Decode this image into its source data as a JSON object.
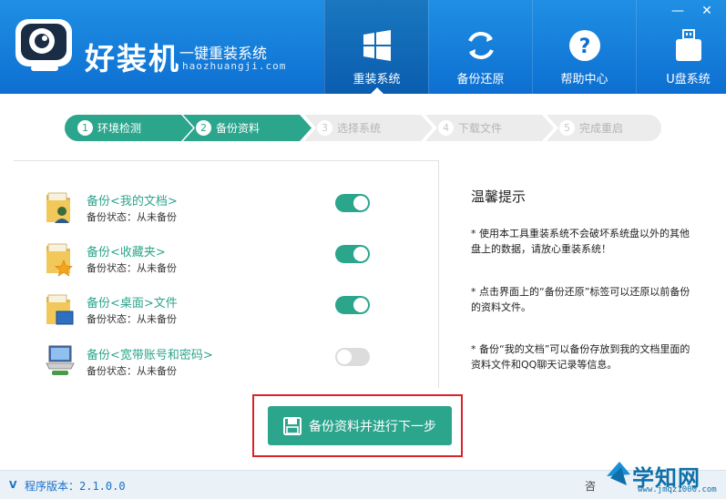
{
  "header": {
    "brand_name": "好装机",
    "slogan": "一键重装系统",
    "domain": "haozhuangji.com",
    "window_controls": {
      "minimize": "—",
      "close": "✕"
    },
    "nav": [
      {
        "label": "重装系统",
        "icon": "windows-icon",
        "active": true
      },
      {
        "label": "备份还原",
        "icon": "sync-icon",
        "active": false
      },
      {
        "label": "帮助中心",
        "icon": "help-icon",
        "active": false
      },
      {
        "label": "U盘系统",
        "icon": "usb-icon",
        "active": false,
        "badge": "USB"
      }
    ]
  },
  "steps": [
    {
      "num": "1",
      "label": "环境检测",
      "state": "done"
    },
    {
      "num": "2",
      "label": "备份资料",
      "state": "done"
    },
    {
      "num": "3",
      "label": "选择系统",
      "state": "todo"
    },
    {
      "num": "4",
      "label": "下载文件",
      "state": "todo"
    },
    {
      "num": "5",
      "label": "完成重启",
      "state": "todo"
    }
  ],
  "backup_items": [
    {
      "title": "备份<我的文档>",
      "status": "备份状态：从未备份",
      "enabled": true,
      "icon": "documents-folder-icon"
    },
    {
      "title": "备份<收藏夹>",
      "status": "备份状态：从未备份",
      "enabled": true,
      "icon": "favorites-folder-icon"
    },
    {
      "title": "备份<桌面>文件",
      "status": "备份状态：从未备份",
      "enabled": true,
      "icon": "desktop-folder-icon"
    },
    {
      "title": "备份<宽带账号和密码>",
      "status": "备份状态：从未备份",
      "enabled": false,
      "icon": "network-icon"
    }
  ],
  "tips": {
    "title": "温馨提示",
    "items": [
      "* 使用本工具重装系统不会破坏系统盘以外的其他盘上的数据，请放心重装系统！",
      "* 点击界面上的“备份还原”标签可以还原以前备份的资料文件。",
      "* 备份“我的文档”可以备份存放到我的文档里面的资料文件和QQ聊天记录等信息。"
    ]
  },
  "action": {
    "primary_label": "备份资料并进行下一步"
  },
  "footer": {
    "version_prefix": "V",
    "version_text": "程序版本：2.1.0.0",
    "right_text": "咨"
  },
  "watermark": {
    "text": "学知网",
    "url": "www.jmqz1000.com"
  },
  "colors": {
    "header": "#0d6fd1",
    "accent": "#2ca58d",
    "highlight": "#d9232a"
  }
}
